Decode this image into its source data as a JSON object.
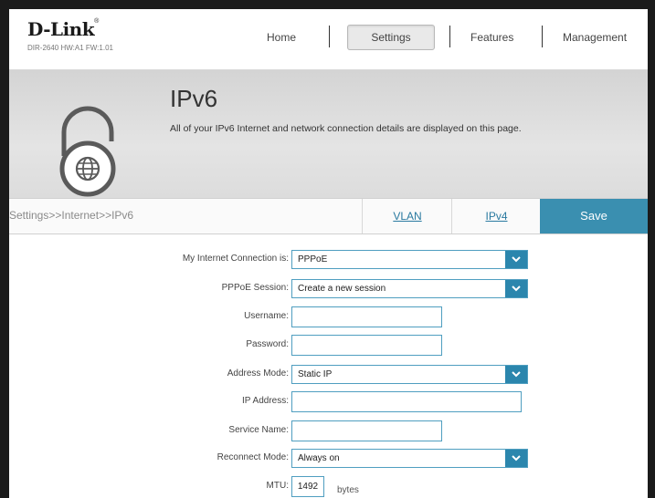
{
  "brand": {
    "logo": "D-Link",
    "hw_info": "DIR-2640 HW:A1 FW:1.01"
  },
  "nav": {
    "home": "Home",
    "settings": "Settings",
    "features": "Features",
    "management": "Management"
  },
  "banner": {
    "title": "IPv6",
    "description": "All of your IPv6 Internet and network connection details are displayed on this page."
  },
  "subbar": {
    "breadcrumb": "Settings>>Internet>>IPv6",
    "vlan": "VLAN",
    "ipv4": "IPv4",
    "save": "Save"
  },
  "form": {
    "connection": {
      "label": "My Internet Connection is:",
      "value": "PPPoE"
    },
    "session": {
      "label": "PPPoE Session:",
      "value": "Create a new session"
    },
    "username": {
      "label": "Username:",
      "value": ""
    },
    "password": {
      "label": "Password:",
      "value": ""
    },
    "address_mode": {
      "label": "Address Mode:",
      "value": "Static IP"
    },
    "ip_address": {
      "label": "IP Address:",
      "value": ""
    },
    "service_name": {
      "label": "Service Name:",
      "value": ""
    },
    "reconnect_mode": {
      "label": "Reconnect Mode:",
      "value": "Always on"
    },
    "mtu": {
      "label": "MTU:",
      "value": "1492",
      "unit": "bytes"
    }
  },
  "colors": {
    "accent": "#3a8fb0",
    "dropdown": "#2b86ad",
    "border": "#4f9ec0"
  }
}
